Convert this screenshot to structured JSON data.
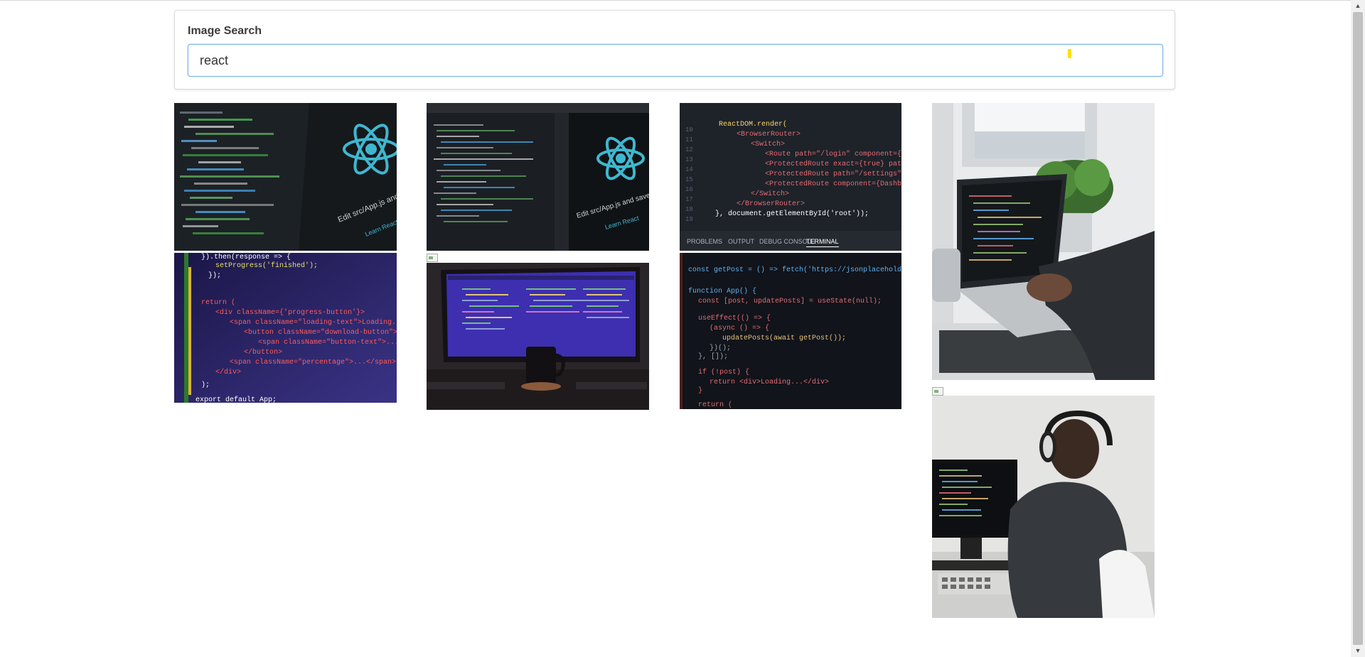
{
  "search": {
    "label": "Image Search",
    "value": "react"
  },
  "results": [
    {
      "icon": "react-logo-code-image",
      "caption": "Edit src/App.js and save to reload.",
      "link": "Learn React"
    },
    {
      "icon": "react-logo-editor-image",
      "caption": "Edit src/App.js and save to reload.",
      "link": "Learn React"
    },
    {
      "icon": "react-router-code-image",
      "lines": [
        "ReactDOM.render(",
        "<BrowserRouter>",
        "<Switch>",
        "<Route path=\"/login\" component={Login} />",
        "<ProtectedRoute exact={true} path=\"/\" />",
        "<ProtectedRoute path=\"/settings\" />",
        "<ProtectedRoute component={Dashboard} />",
        "</Switch>",
        "</BrowserRouter>",
        "}, document.getElementById('root'));"
      ],
      "tabs": [
        "PROBLEMS",
        "OUTPUT",
        "DEBUG CONSOLE",
        "TERMINAL"
      ]
    },
    {
      "icon": "laptop-on-desk-image"
    },
    {
      "icon": "progress-button-code-image",
      "lines": [
        "}).then(response => {",
        "setProgress('finished');",
        "});",
        "return (",
        "<div className={'progress-button'}>",
        "<span className=\"loading-text\">Loading...</span>",
        "<button className=\"download-button\">",
        "<span className=\"button-text\">...</span>",
        "</button>",
        "<span className=\"percentage\">...</span>",
        "</div>",
        ");",
        "export default App;"
      ]
    },
    {
      "icon": "monitor-and-mug-image"
    },
    {
      "icon": "fetch-posts-code-image",
      "lines": [
        "const getPost = () => fetch('https://jsonplaceholder...')",
        "function App() {",
        "const [post, updatePosts] = useState(null);",
        "useEffect(() => {",
        "(async () => {",
        "updatePosts(await getPost());",
        "})();",
        "}, []);",
        "if (!post) {",
        "return <div>Loading...</div>",
        "}",
        "return ("
      ]
    },
    {
      "icon": "developer-with-headphones-image"
    }
  ],
  "colors": {
    "code_bg": "#1e2229",
    "react_cyan": "#3fb7d0",
    "code_purple_bg": "#2f2a6b"
  }
}
